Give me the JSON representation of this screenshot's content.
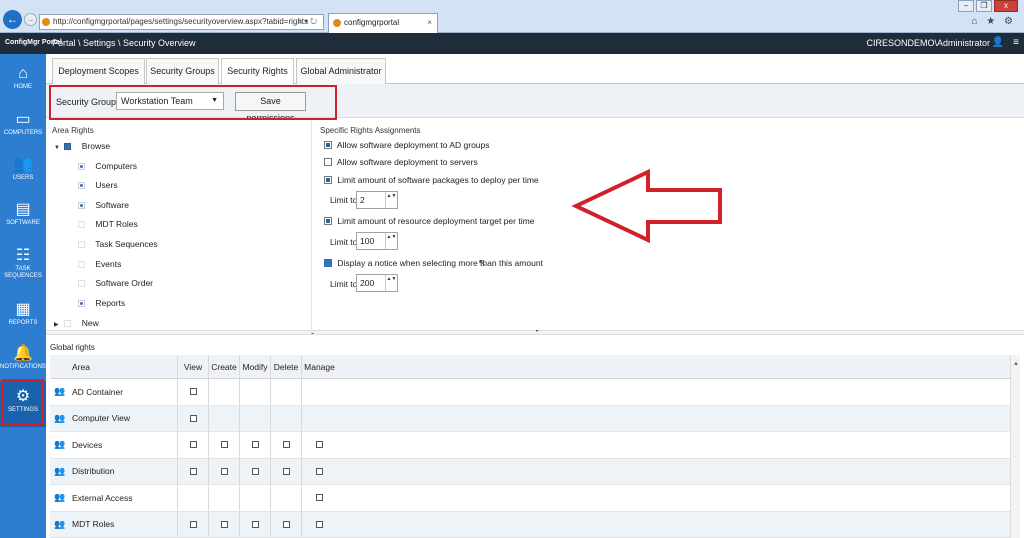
{
  "browser": {
    "url": "http://configmgrportal/pages/settings/securityoverview.aspx?tabid=rights",
    "address_tools": "⌕ ▾ ↻",
    "tab_title": "configmgrportal",
    "tab_close": "×",
    "window_minimize": "–",
    "window_restore": "❐",
    "window_close": "x",
    "icons": "⌂ ★ ⚙"
  },
  "header": {
    "logo": "ConfigMgr Portal",
    "breadcrumb": "Portal \\ Settings \\ Security Overview",
    "user": "CIRESONDEMO\\Administrator"
  },
  "sidebar": {
    "items": [
      {
        "label": "HOME",
        "icon": "⌂"
      },
      {
        "label": "COMPUTERS",
        "icon": "▭"
      },
      {
        "label": "USERS",
        "icon": "👥"
      },
      {
        "label": "SOFTWARE",
        "icon": "▤"
      },
      {
        "label": "TASK SEQUENCES",
        "icon": "☷"
      },
      {
        "label": "REPORTS",
        "icon": "▦"
      },
      {
        "label": "NOTIFICATIONS",
        "icon": "🔔"
      },
      {
        "label": "SETTINGS",
        "icon": "⚙"
      }
    ]
  },
  "tabs": [
    "Deployment Scopes",
    "Security Groups",
    "Security Rights",
    "Global Administrator"
  ],
  "toolbar": {
    "security_group_label": "Security Group :",
    "security_group_value": "Workstation Team",
    "caret": "▼",
    "save_label": "Save permissions"
  },
  "area_rights": {
    "title": "Area Rights",
    "items": [
      {
        "label": "Browse",
        "level": 0,
        "state": "on",
        "expanded": true
      },
      {
        "label": "Computers",
        "level": 1,
        "state": "dot"
      },
      {
        "label": "Users",
        "level": 1,
        "state": "dot"
      },
      {
        "label": "Software",
        "level": 1,
        "state": "dot"
      },
      {
        "label": "MDT Roles",
        "level": 1,
        "state": "dim"
      },
      {
        "label": "Task Sequences",
        "level": 1,
        "state": "dim"
      },
      {
        "label": "Events",
        "level": 1,
        "state": "dim"
      },
      {
        "label": "Software Order",
        "level": 1,
        "state": "dim"
      },
      {
        "label": "Reports",
        "level": 1,
        "state": "dot"
      },
      {
        "label": "New",
        "level": 0,
        "state": "dim",
        "expanded": false
      }
    ],
    "arrow_expanded": "▼",
    "arrow_collapsed": "▶"
  },
  "specific_rights": {
    "title": "Specific Rights Assignments",
    "rules": [
      {
        "label": "Allow software deployment to AD groups",
        "checked": true
      },
      {
        "label": "Allow software deployment to servers",
        "checked": false
      },
      {
        "label": "Limit amount of software packages to deploy per time",
        "checked": true
      },
      {
        "label": "Limit amount of resource deployment target per time",
        "checked": true
      },
      {
        "label": "Display a notice when selecting more than this amount",
        "checked": true
      }
    ],
    "limit_label": "Limit to",
    "limits": [
      "2",
      "100",
      "200"
    ],
    "spinner_arrows": "▲▼"
  },
  "global_rights": {
    "title": "Global rights",
    "columns": [
      "Area",
      "View",
      "Create",
      "Modify",
      "Delete",
      "Manage"
    ],
    "rows": [
      {
        "area": "AD Container",
        "checks": [
          true,
          false,
          false,
          false,
          false
        ]
      },
      {
        "area": "Computer View",
        "checks": [
          true,
          false,
          false,
          false,
          false
        ]
      },
      {
        "area": "Devices",
        "checks": [
          true,
          true,
          true,
          true,
          true
        ]
      },
      {
        "area": "Distribution",
        "checks": [
          true,
          true,
          true,
          true,
          true
        ]
      },
      {
        "area": "External Access",
        "checks": [
          false,
          false,
          false,
          false,
          true
        ]
      },
      {
        "area": "MDT Roles",
        "checks": [
          true,
          true,
          true,
          true,
          true
        ]
      }
    ]
  },
  "colors": {
    "accent": "#2d7dd1",
    "header": "#1f2c3a",
    "annotation": "#d0202a"
  }
}
